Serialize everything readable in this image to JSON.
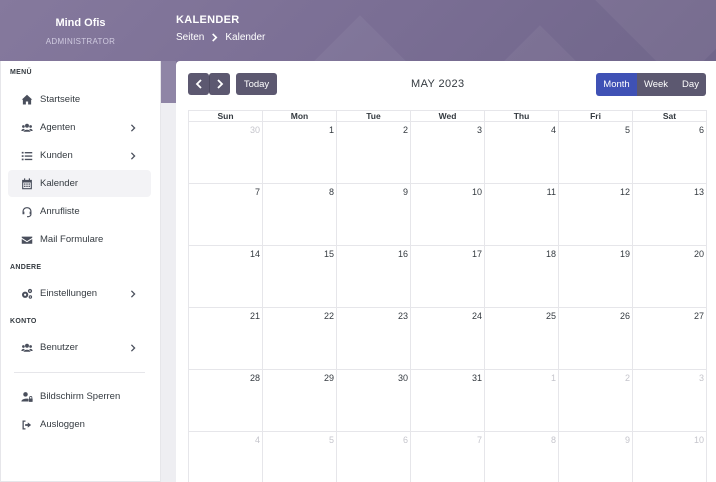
{
  "sidebar": {
    "brand": "Mind Ofis",
    "role": "ADMINISTRATOR",
    "sections": {
      "menu": "MENÜ",
      "other": "ANDERE",
      "account": "KONTO"
    },
    "items": [
      {
        "label": "Startseite",
        "icon": "home-icon"
      },
      {
        "label": "Agenten",
        "icon": "users-icon"
      },
      {
        "label": "Kunden",
        "icon": "list-icon"
      },
      {
        "label": "Kalender",
        "icon": "calendar-icon"
      },
      {
        "label": "Anrufliste",
        "icon": "headset-icon"
      },
      {
        "label": "Mail Formulare",
        "icon": "envelope-icon"
      },
      {
        "label": "Einstellungen",
        "icon": "gears-icon"
      },
      {
        "label": "Benutzer",
        "icon": "users-icon"
      },
      {
        "label": "Bildschirm Sperren",
        "icon": "user-lock-icon"
      },
      {
        "label": "Ausloggen",
        "icon": "sign-out-icon"
      }
    ],
    "active_item": "Kalender"
  },
  "header": {
    "title": "KALENDER",
    "breadcrumb": [
      "Seiten",
      "Kalender"
    ]
  },
  "calendar": {
    "today_label": "Today",
    "month_title": "MAY 2023",
    "views": [
      "Month",
      "Week",
      "Day"
    ],
    "active_view": "Month",
    "weekdays": [
      "Sun",
      "Mon",
      "Tue",
      "Wed",
      "Thu",
      "Fri",
      "Sat"
    ],
    "weeks": [
      [
        {
          "d": "30",
          "o": true
        },
        {
          "d": "1"
        },
        {
          "d": "2"
        },
        {
          "d": "3"
        },
        {
          "d": "4"
        },
        {
          "d": "5"
        },
        {
          "d": "6"
        }
      ],
      [
        {
          "d": "7"
        },
        {
          "d": "8"
        },
        {
          "d": "9"
        },
        {
          "d": "10"
        },
        {
          "d": "11"
        },
        {
          "d": "12"
        },
        {
          "d": "13"
        }
      ],
      [
        {
          "d": "14"
        },
        {
          "d": "15"
        },
        {
          "d": "16"
        },
        {
          "d": "17"
        },
        {
          "d": "18"
        },
        {
          "d": "19"
        },
        {
          "d": "20"
        }
      ],
      [
        {
          "d": "21"
        },
        {
          "d": "22"
        },
        {
          "d": "23"
        },
        {
          "d": "24"
        },
        {
          "d": "25"
        },
        {
          "d": "26"
        },
        {
          "d": "27"
        }
      ],
      [
        {
          "d": "28"
        },
        {
          "d": "29"
        },
        {
          "d": "30"
        },
        {
          "d": "31"
        },
        {
          "d": "1",
          "o": true
        },
        {
          "d": "2",
          "o": true
        },
        {
          "d": "3",
          "o": true
        }
      ],
      [
        {
          "d": "4",
          "o": true
        },
        {
          "d": "5",
          "o": true
        },
        {
          "d": "6",
          "o": true
        },
        {
          "d": "7",
          "o": true
        },
        {
          "d": "8",
          "o": true
        },
        {
          "d": "9",
          "o": true
        },
        {
          "d": "10",
          "o": true
        }
      ]
    ]
  },
  "colors": {
    "header": "#7a6e94",
    "accent": "#3f51b5",
    "button": "#5c5870"
  }
}
